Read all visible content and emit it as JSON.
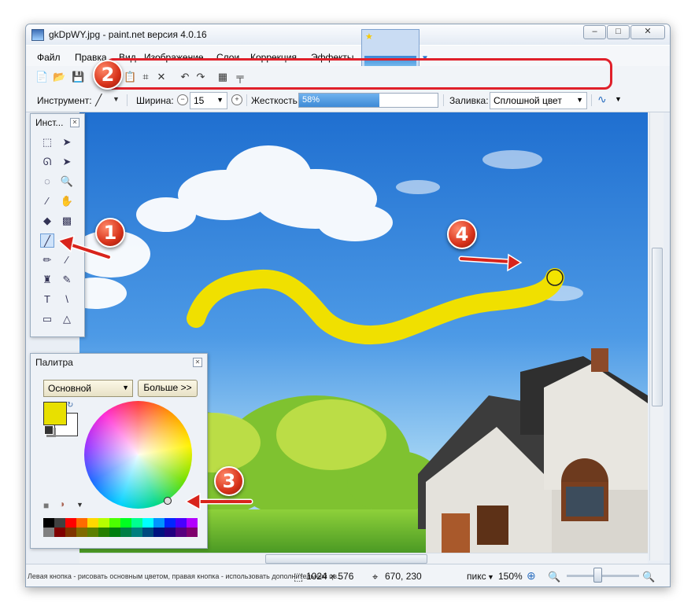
{
  "window": {
    "title": "gkDpWY.jpg - paint.net версия 4.0.16",
    "controls": {
      "minimize": "–",
      "maximize": "□",
      "close": "✕"
    }
  },
  "menu": [
    "Файл",
    "Правка",
    "Вид",
    "Изображение",
    "Слои",
    "Коррекция",
    "Эффекты"
  ],
  "right_tools": [
    {
      "icon": "hammer-icon",
      "glyph": "🔨",
      "selected": true
    },
    {
      "icon": "clock-icon",
      "glyph": "🕒",
      "selected": false
    },
    {
      "icon": "layers-icon",
      "glyph": "▣",
      "selected": false
    },
    {
      "icon": "colors-icon",
      "glyph": "◉",
      "selected": false
    },
    {
      "icon": "gear-icon",
      "glyph": "⚙",
      "selected": false
    },
    {
      "icon": "help-icon",
      "glyph": "?",
      "selected": false
    }
  ],
  "toolbar1_icons": [
    {
      "name": "new-icon",
      "glyph": "📄"
    },
    {
      "name": "open-icon",
      "glyph": "📂"
    },
    {
      "name": "save-icon",
      "glyph": "💾"
    },
    {
      "name": "cut-icon",
      "glyph": "✂"
    },
    {
      "name": "copy-icon",
      "glyph": "❐"
    },
    {
      "name": "paste-icon",
      "glyph": "📋"
    },
    {
      "name": "crop-icon",
      "glyph": "⌗"
    },
    {
      "name": "deselect-icon",
      "glyph": "✕"
    },
    {
      "name": "undo-icon",
      "glyph": "↶"
    },
    {
      "name": "redo-icon",
      "glyph": "↷"
    },
    {
      "name": "grid-icon",
      "glyph": "▦"
    },
    {
      "name": "ruler-icon",
      "glyph": "╤"
    }
  ],
  "options": {
    "tool_label": "Инструмент:",
    "width_label": "Ширина:",
    "width_value": "15",
    "hardness_label": "Жесткость:",
    "hardness_value": "58%",
    "hardness_fraction": 0.58,
    "fill_label": "Заливка:",
    "fill_value": "Сплошной цвет"
  },
  "tools_panel": {
    "title": "Инст...",
    "tools": [
      {
        "name": "rectangle-select-icon",
        "glyph": "⬚"
      },
      {
        "name": "move-selection-icon",
        "glyph": "➤"
      },
      {
        "name": "lasso-select-icon",
        "glyph": "ᘏ"
      },
      {
        "name": "move-selected-icon",
        "glyph": "➤"
      },
      {
        "name": "ellipse-select-icon",
        "glyph": "◌"
      },
      {
        "name": "zoom-icon",
        "glyph": "🔍"
      },
      {
        "name": "magic-wand-icon",
        "glyph": "⁄"
      },
      {
        "name": "pan-icon",
        "glyph": "✋"
      },
      {
        "name": "paint-bucket-icon",
        "glyph": "◆"
      },
      {
        "name": "gradient-icon",
        "glyph": "▩"
      },
      {
        "name": "paintbrush-icon",
        "glyph": "╱",
        "selected": true
      },
      {
        "name": "eraser-icon",
        "glyph": "▱"
      },
      {
        "name": "pencil-icon",
        "glyph": "✏"
      },
      {
        "name": "color-picker-icon",
        "glyph": "⁄"
      },
      {
        "name": "clone-stamp-icon",
        "glyph": "♜"
      },
      {
        "name": "recolor-icon",
        "glyph": "✎"
      },
      {
        "name": "text-icon",
        "glyph": "T"
      },
      {
        "name": "line-curve-icon",
        "glyph": "\\"
      },
      {
        "name": "shapes-icon",
        "glyph": "▭"
      },
      {
        "name": "shapes-triangle-icon",
        "glyph": "△"
      }
    ]
  },
  "palette": {
    "title": "Палитра",
    "mode": "Основной",
    "more_button": "Больше >>",
    "primary_color": "#e8e000",
    "secondary_color": "#ffffff",
    "swatches": [
      "#000000",
      "#404040",
      "#ff0000",
      "#ff6a00",
      "#ffd800",
      "#b6ff00",
      "#4cff00",
      "#00ff21",
      "#00ff90",
      "#00ffff",
      "#0094ff",
      "#0026ff",
      "#4800ff",
      "#b200ff",
      "#808080",
      "#7f0000",
      "#7f3300",
      "#7f6a00",
      "#5b7f00",
      "#267f00",
      "#007f0e",
      "#007f46",
      "#007f7f",
      "#004a7f",
      "#00137f",
      "#21007f",
      "#57007f",
      "#7f006e"
    ]
  },
  "status": {
    "hint": "Левая кнопка - рисовать основным цветом, правая кнопка - использовать дополнительный цв...",
    "image_size": "1024 × 576",
    "cursor_pos": "670, 230",
    "units": "пикс",
    "zoom": "150%"
  },
  "badges": [
    {
      "label": "1",
      "color": "#d7321a"
    },
    {
      "label": "2",
      "color": "#d7321a"
    },
    {
      "label": "3",
      "color": "#d7321a"
    },
    {
      "label": "4",
      "color": "#d7321a"
    }
  ]
}
